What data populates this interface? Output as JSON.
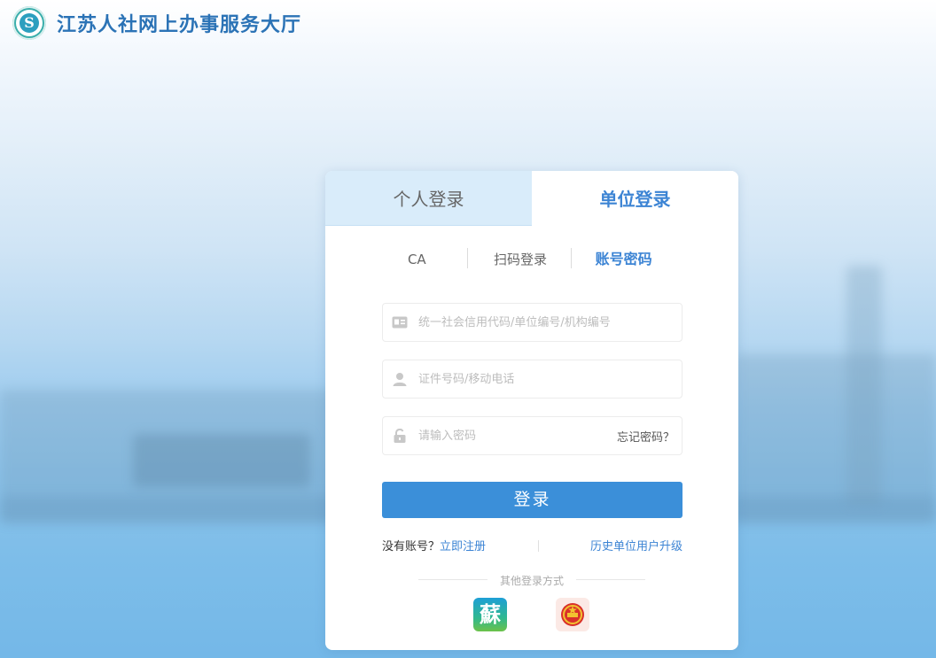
{
  "header": {
    "title": "江苏人社网上办事服务大厅",
    "logo_icon": "jiangsu-hrss-logo-icon"
  },
  "login": {
    "tabs": [
      {
        "label": "个人登录",
        "active": false
      },
      {
        "label": "单位登录",
        "active": true
      }
    ],
    "subtabs": [
      {
        "label": "CA",
        "active": false
      },
      {
        "label": "扫码登录",
        "active": false
      },
      {
        "label": "账号密码",
        "active": true
      }
    ],
    "fields": {
      "org_code_placeholder": "统一社会信用代码/单位编号/机构编号",
      "id_phone_placeholder": "证件号码/移动电话",
      "password_placeholder": "请输入密码",
      "forgot_label": "忘记密码？"
    },
    "submit_label": "登录",
    "no_account_text": "没有账号？",
    "register_label": "立即注册",
    "upgrade_label": "历史单位用户升级",
    "other_methods_label": "其他登录方式",
    "other_apps": [
      {
        "name": "su-service-app-icon",
        "glyph": "蘇"
      },
      {
        "name": "national-emblem-icon"
      }
    ]
  },
  "colors": {
    "accent": "#3c84d4",
    "button": "#3b8fd9",
    "brand_title": "#2b73b6"
  }
}
